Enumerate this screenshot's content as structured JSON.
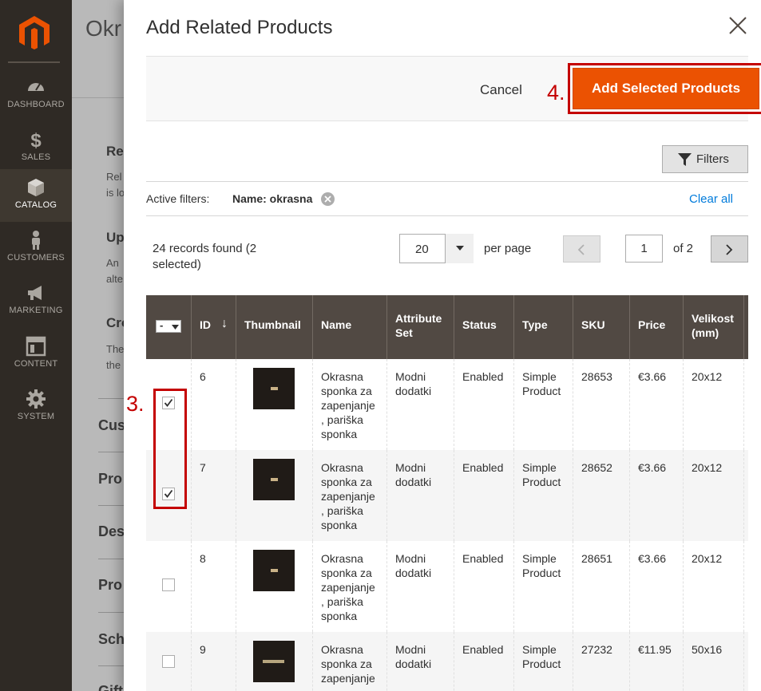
{
  "sidebar": {
    "items": [
      {
        "label": "DASHBOARD",
        "icon": "dashboard-icon"
      },
      {
        "label": "SALES",
        "icon": "dollar-icon"
      },
      {
        "label": "CATALOG",
        "icon": "cube-icon",
        "active": true
      },
      {
        "label": "CUSTOMERS",
        "icon": "person-icon"
      },
      {
        "label": "MARKETING",
        "icon": "megaphone-icon"
      },
      {
        "label": "CONTENT",
        "icon": "layout-icon"
      },
      {
        "label": "SYSTEM",
        "icon": "gear-icon"
      }
    ]
  },
  "background_page": {
    "title": "Okr",
    "headings": [
      "Re",
      "Rel",
      "is lo",
      "Up",
      "An",
      "alte",
      "Cro",
      "The",
      "the"
    ],
    "sections": [
      "Cus",
      "Pro",
      "Des",
      "Pro",
      "Sch",
      "Gift"
    ]
  },
  "modal": {
    "title": "Add Related Products",
    "cancel_label": "Cancel",
    "add_label": "Add Selected Products",
    "filters_label": "Filters",
    "active_filters_label": "Active filters:",
    "active_filter_value": "Name: okrasna",
    "clear_all_label": "Clear all",
    "records_text": "24 records found (2 selected)",
    "per_page_value": "20",
    "per_page_label": "per page",
    "current_page": "1",
    "of_pages": "of 2"
  },
  "annotations": {
    "step3": "3.",
    "step4": "4."
  },
  "grid": {
    "mass_select": "-",
    "columns": [
      "ID",
      "Thumbnail",
      "Name",
      "Attribute Set",
      "Status",
      "Type",
      "SKU",
      "Price",
      "Velikost (mm)"
    ],
    "rows": [
      {
        "checked": true,
        "id": "6",
        "name": "Okrasna sponka za zapenjanje , pariška sponka",
        "attribute_set": "Modni dodatki",
        "status": "Enabled",
        "type": "Simple Product",
        "sku": "28653",
        "price": "€3.66",
        "size": "20x12"
      },
      {
        "checked": true,
        "id": "7",
        "name": "Okrasna sponka za zapenjanje , pariška sponka",
        "attribute_set": "Modni dodatki",
        "status": "Enabled",
        "type": "Simple Product",
        "sku": "28652",
        "price": "€3.66",
        "size": "20x12"
      },
      {
        "checked": false,
        "id": "8",
        "name": "Okrasna sponka za zapenjanje , pariška sponka",
        "attribute_set": "Modni dodatki",
        "status": "Enabled",
        "type": "Simple Product",
        "sku": "28651",
        "price": "€3.66",
        "size": "20x12"
      },
      {
        "checked": false,
        "id": "9",
        "name": "Okrasna sponka za zapenjanje",
        "attribute_set": "Modni dodatki",
        "status": "Enabled",
        "type": "Simple Product",
        "sku": "27232",
        "price": "€11.95",
        "size": "50x16"
      }
    ]
  },
  "colors": {
    "sidebar_bg": "#2f2a25",
    "accent_orange": "#eb5202",
    "grid_header": "#514943",
    "link_blue": "#007bdb",
    "annotation_red": "#c40000"
  }
}
